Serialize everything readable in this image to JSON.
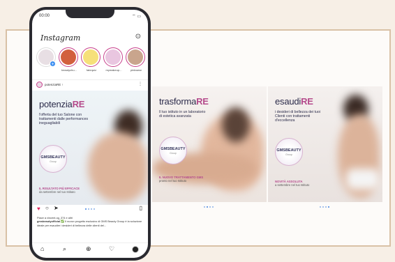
{
  "phone": {
    "status_time": "00:00",
    "status_icons": "⌔ ▭",
    "app_title": "Instagram",
    "stories": [
      {
        "name": "",
        "own": true,
        "color": "#e8dfe4"
      },
      {
        "name": "beautychu...",
        "own": false,
        "color": "#d2603e"
      },
      {
        "name": "fabrquiz",
        "own": false,
        "color": "#f6e07a"
      },
      {
        "name": "mymakeup...",
        "own": false,
        "color": "#e9c6e0"
      },
      {
        "name": "pinkwear",
        "own": false,
        "color": "#c9a58d"
      }
    ],
    "post_user": "potenziaRE ↑",
    "caption_likes": "Piace a vincent.og_374 e altri",
    "caption_user": "gmsbeautyofficial",
    "caption_text": "✅ Il nuovo progetto esclusivo di GMS Beauty Group è la soluzione ideale per esaudire i desideri di bellezza delle clienti del..."
  },
  "slides": [
    {
      "title_light": "potenzia",
      "title_bold": "RE",
      "subtitle": "l'offerta del tuo Salone con trattamenti dalle performances ineguagliabili",
      "logo_text": "GMSBEAUTY",
      "logo_sub": "Group",
      "footer_bold": "IL RISULTATO PIÙ EFFICACE",
      "footer_rest": "da settembre nel tuo Istituto"
    },
    {
      "title_light": "trasforma",
      "title_bold": "RE",
      "subtitle": "Il tuo istituto in un laboratorio di estetica avanzata",
      "logo_text": "GMSBEAUTY",
      "logo_sub": "Group",
      "footer_bold": "IL NUOVO TRATTAMENTO GMS",
      "footer_rest": "pronto nel tuo Istituto"
    },
    {
      "title_light": "esaudi",
      "title_bold": "RE",
      "subtitle": "i desideri di bellezza dei tuoi Clienti con trattamenti d'eccellenza",
      "logo_text": "GMSBEAUTY",
      "logo_sub": "Group",
      "footer_bold": "NOVITÀ ASSOLUTA",
      "footer_rest": "a settembre nel tuo Istituto"
    }
  ],
  "colors": {
    "background": "#f7efe6",
    "frame_border": "#d9c1a6",
    "accent_pink": "#b54b8c",
    "text_navy": "#2b2b4a"
  },
  "icons": {
    "heart": "♥",
    "comment": "○",
    "share": "➤",
    "save": "▯",
    "dm": "⊙",
    "home": "⌂",
    "search": "⌕",
    "add": "⊕",
    "activity": "♡",
    "more": "⋮"
  }
}
